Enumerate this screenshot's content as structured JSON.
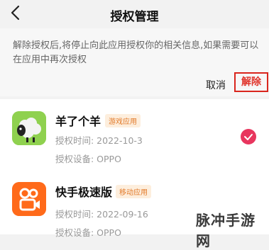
{
  "header": {
    "title": "授权管理"
  },
  "dialog": {
    "message": "解除授权后,将停止向此应用授权你的相关信息,如果需要可以在应用中再次授权",
    "cancel_label": "取消",
    "remove_label": "解除"
  },
  "apps": [
    {
      "name": "羊了个羊",
      "tag": "游戏应用",
      "time": "授权时间: 2022-10-3",
      "device": "授权设备: OPPO",
      "selected": true
    },
    {
      "name": "快手极速版",
      "tag": "移动应用",
      "time": "授权时间: 2022-09-16",
      "device": "授权设备: OPPO",
      "selected": false
    }
  ],
  "watermark": "脉冲手游网",
  "colors": {
    "accent": "#e8365e",
    "remove_border": "#d9251d",
    "tag_text": "#e27a2a",
    "kuaishou_icon": "#ff6a1a"
  }
}
